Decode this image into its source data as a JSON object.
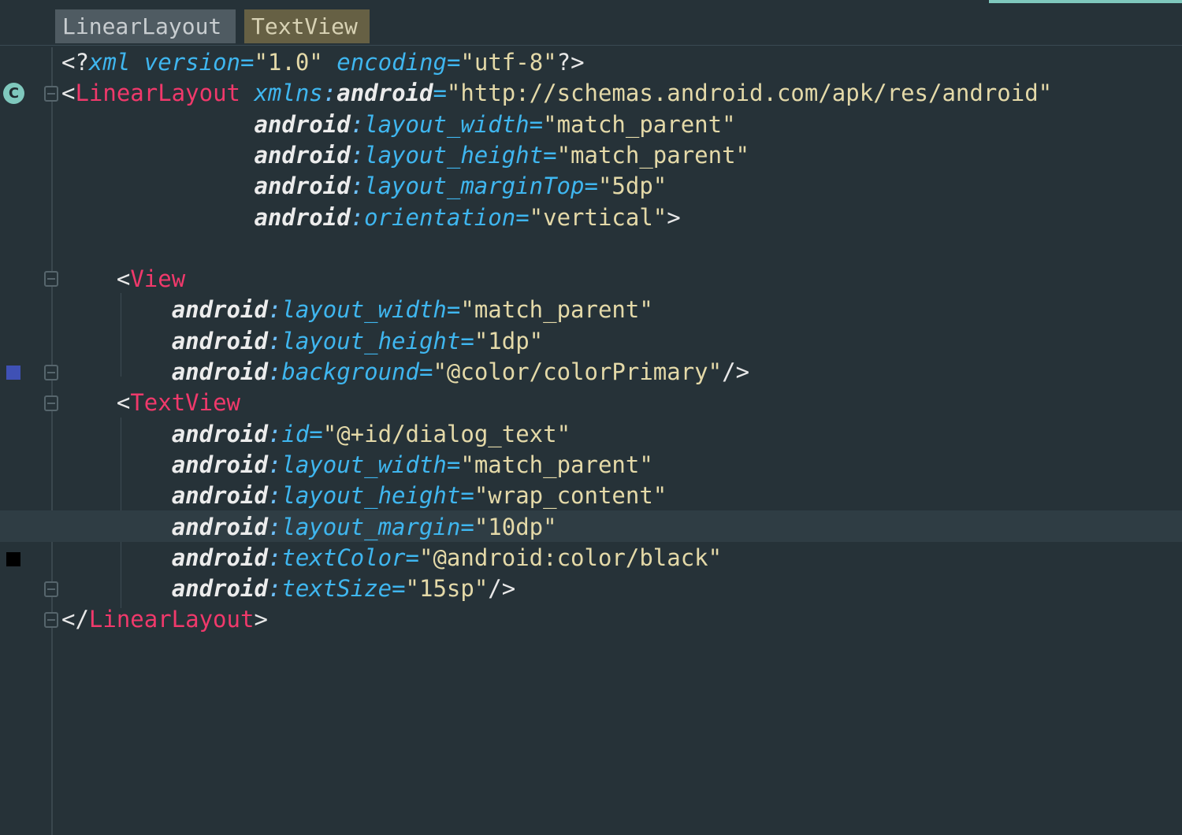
{
  "editor": {
    "breadcrumbs": [
      "LinearLayout",
      "TextView"
    ],
    "gutter": {
      "class_marker": "C",
      "swatches": [
        {
          "name": "colorPrimary",
          "color": "#3f51b5"
        },
        {
          "name": "black",
          "color": "#000000"
        }
      ]
    },
    "code_lines": [
      "<?xml version=\"1.0\" encoding=\"utf-8\"?>",
      "<LinearLayout xmlns:android=\"http://schemas.android.com/apk/res/android\"",
      "              android:layout_width=\"match_parent\"",
      "              android:layout_height=\"match_parent\"",
      "              android:layout_marginTop=\"5dp\"",
      "              android:orientation=\"vertical\">",
      "",
      "    <View",
      "        android:layout_width=\"match_parent\"",
      "        android:layout_height=\"1dp\"",
      "        android:background=\"@color/colorPrimary\"/>",
      "    <TextView",
      "        android:id=\"@+id/dialog_text\"",
      "        android:layout_width=\"match_parent\"",
      "        android:layout_height=\"wrap_content\"",
      "        android:layout_margin=\"10dp\"",
      "        android:textColor=\"@android:color/black\"",
      "        android:textSize=\"15sp\"/>",
      "</LinearLayout>"
    ],
    "highlighted_line": 16
  }
}
